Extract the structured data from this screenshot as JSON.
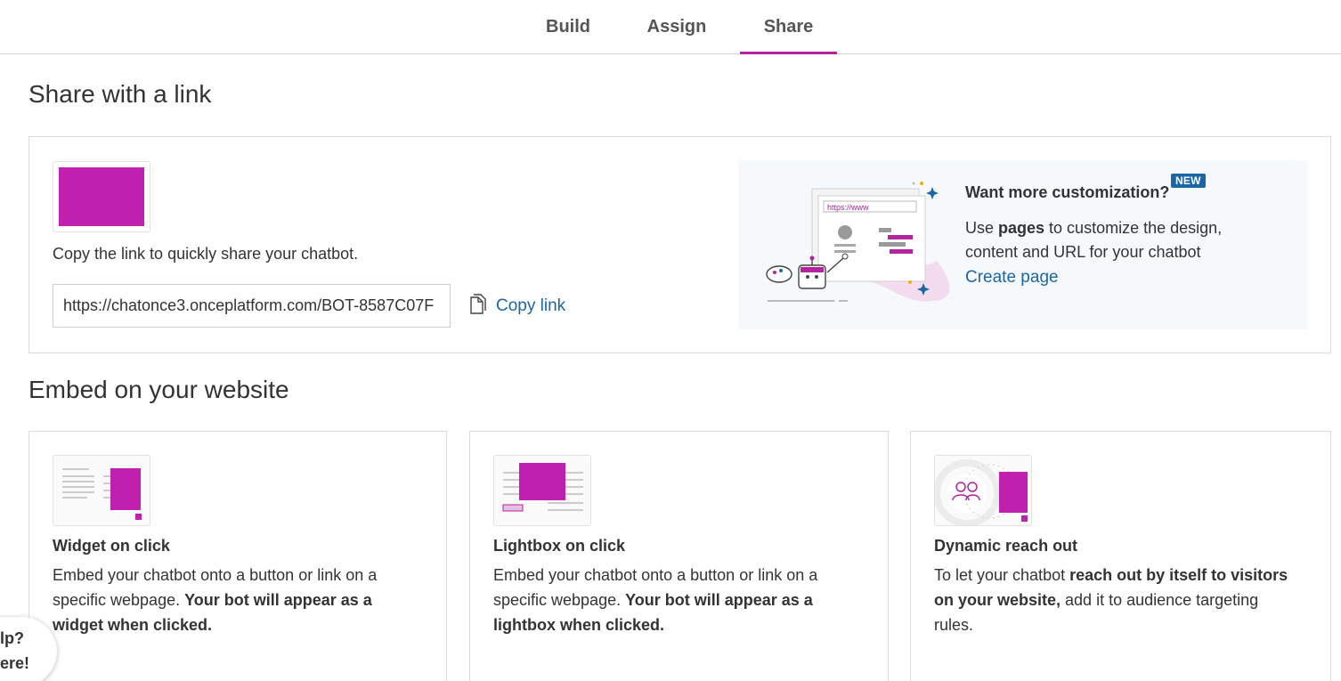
{
  "tabs": [
    {
      "label": "Build"
    },
    {
      "label": "Assign"
    },
    {
      "label": "Share",
      "active": true
    }
  ],
  "share": {
    "title": "Share with a link",
    "description": "Copy the link to quickly share your chatbot.",
    "link_value": "https://chatonce3.onceplatform.com/BOT-8587C07F",
    "copy_label": "Copy link",
    "promo": {
      "title": "Want more customization?",
      "badge": "NEW",
      "text_before": "Use ",
      "text_bold": "pages",
      "text_after": " to customize the design, content and URL for your chatbot",
      "link": "Create page",
      "illustration_url": "https://www"
    }
  },
  "embed": {
    "title": "Embed on your website",
    "cards": [
      {
        "title": "Widget on click",
        "desc_plain": "Embed your chatbot onto a button or link on a specific webpage. ",
        "desc_bold": "Your bot will appear as a widget when clicked."
      },
      {
        "title": "Lightbox on click",
        "desc_plain": "Embed your chatbot onto a button or link on a specific webpage. ",
        "desc_bold": "Your bot will appear as a lightbox when clicked."
      },
      {
        "title": "Dynamic reach out",
        "desc_plain_1": "To let your chatbot ",
        "desc_bold": "reach out by itself to visitors on your website,",
        "desc_plain_2": " add it to audience targeting rules."
      }
    ]
  },
  "help": {
    "line1": "lp?",
    "line2": "ere!"
  },
  "colors": {
    "accent": "#c020b0",
    "link": "#1a66a6",
    "tab_underline": "#b4249f"
  }
}
